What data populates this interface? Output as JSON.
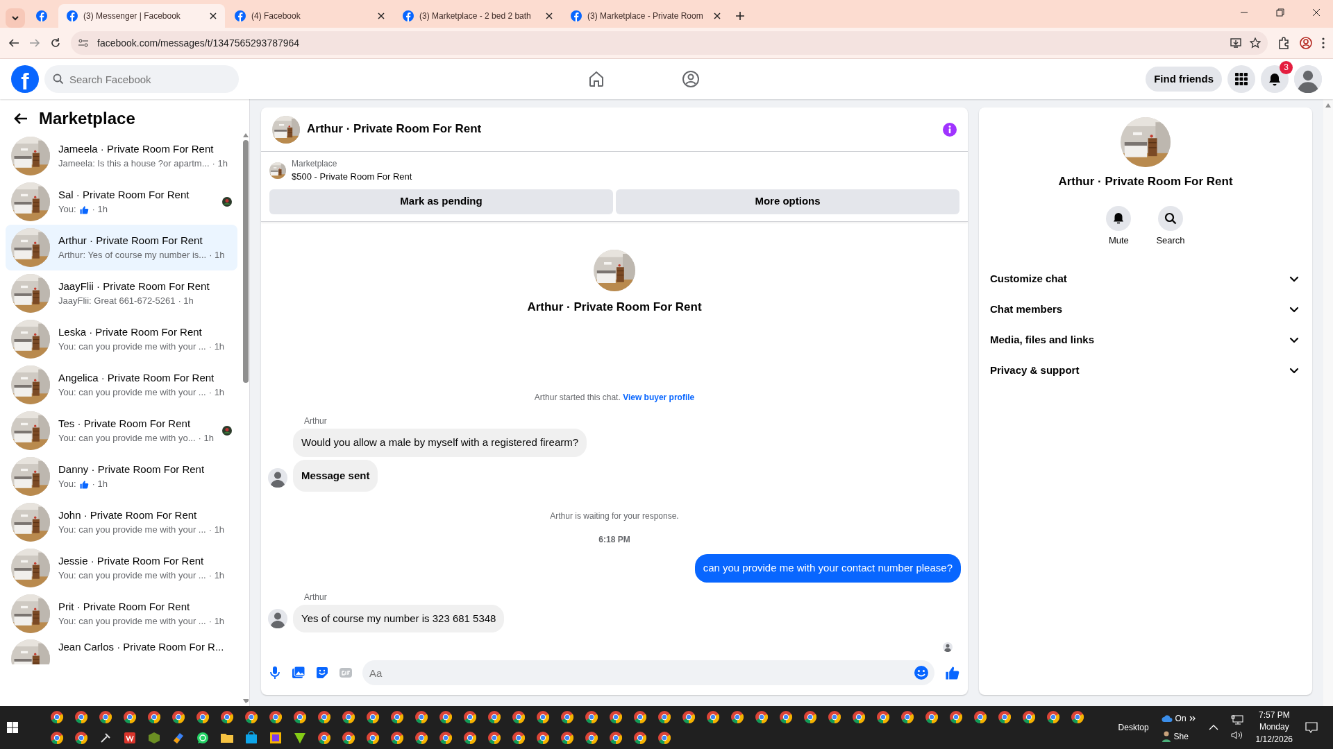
{
  "browser": {
    "tabs": [
      {
        "kind": "pinned",
        "selected": false
      },
      {
        "kind": "page",
        "title": "(3) Messenger | Facebook",
        "selected": true
      },
      {
        "kind": "page",
        "title": "(4) Facebook",
        "selected": false
      },
      {
        "kind": "page",
        "title": "(3) Marketplace - 2 bed 2 bath",
        "selected": false
      },
      {
        "kind": "page",
        "title": "(3) Marketplace - Private Room",
        "selected": false
      }
    ],
    "address": "facebook.com/messages/t/1347565293787964"
  },
  "header": {
    "logo": "f",
    "search_placeholder": "Search Facebook",
    "find_friends": "Find friends",
    "notification_count": "3"
  },
  "sidebar": {
    "title": "Marketplace",
    "conversations": [
      {
        "name": "Jameela · Private Room For Rent",
        "kind": "text",
        "preview": "Jameela: Is this a house ?or apartm...",
        "time": "· 1h",
        "selected": false,
        "read_receipt": false
      },
      {
        "name": "Sal · Private Room For Rent",
        "kind": "like",
        "preview": "You:",
        "time": "· 1h",
        "selected": false,
        "read_receipt": true
      },
      {
        "name": "Arthur · Private Room For Rent",
        "kind": "text",
        "preview": "Arthur: Yes of course my number is...",
        "time": "· 1h",
        "selected": true,
        "read_receipt": false
      },
      {
        "name": "JaayFlii · Private Room For Rent",
        "kind": "text",
        "preview": "JaayFlii: Great 661-672-5261",
        "time": "· 1h",
        "selected": false,
        "read_receipt": false
      },
      {
        "name": "Leska · Private Room For Rent",
        "kind": "text",
        "preview": "You: can you provide me with your ...",
        "time": "· 1h",
        "selected": false,
        "read_receipt": false
      },
      {
        "name": "Angelica · Private Room For Rent",
        "kind": "text",
        "preview": "You: can you provide me with your ...",
        "time": "· 1h",
        "selected": false,
        "read_receipt": false
      },
      {
        "name": "Tes · Private Room For Rent",
        "kind": "text",
        "preview": "You: can you provide me with yo...",
        "time": "· 1h",
        "selected": false,
        "read_receipt": true
      },
      {
        "name": "Danny · Private Room For Rent",
        "kind": "like",
        "preview": "You:",
        "time": "· 1h",
        "selected": false,
        "read_receipt": false
      },
      {
        "name": "John · Private Room For Rent",
        "kind": "text",
        "preview": "You: can you provide me with your ...",
        "time": "· 1h",
        "selected": false,
        "read_receipt": false
      },
      {
        "name": "Jessie · Private Room For Rent",
        "kind": "text",
        "preview": "You: can you provide me with your ...",
        "time": "· 1h",
        "selected": false,
        "read_receipt": false
      },
      {
        "name": "Prit · Private Room For Rent",
        "kind": "text",
        "preview": "You: can you provide me with your ...",
        "time": "· 1h",
        "selected": false,
        "read_receipt": false
      },
      {
        "name": "Jean Carlos · Private Room For R...",
        "kind": "cut",
        "selected": false,
        "read_receipt": false
      }
    ]
  },
  "chat": {
    "title": "Arthur · Private Room For Rent",
    "listing_label": "Marketplace",
    "listing": "$500 - Private Room For Rent",
    "buttons": [
      "Mark as pending",
      "More options"
    ],
    "intro_name": "Arthur · Private Room For Rent",
    "thread": [
      {
        "kind": "system",
        "text": "Arthur started this chat.",
        "link": "View buyer profile"
      },
      {
        "kind": "incoming",
        "sender": "Arthur",
        "bubbles": [
          {
            "text": "Would you allow a male by myself with a registered firearm?",
            "bold": false
          },
          {
            "text": "Message sent",
            "bold": true
          }
        ]
      },
      {
        "kind": "system",
        "text": "Arthur is waiting for your response."
      },
      {
        "kind": "time",
        "text": "6:18 PM"
      },
      {
        "kind": "outgoing",
        "bubbles": [
          {
            "text": "can you provide me with your contact number please?",
            "bold": false
          }
        ]
      },
      {
        "kind": "incoming",
        "sender": "Arthur",
        "bubbles": [
          {
            "text": "Yes of course my number is 323 681 5348",
            "bold": false
          }
        ]
      },
      {
        "kind": "seen"
      }
    ],
    "composer_placeholder": "Aa"
  },
  "details": {
    "name": "Arthur · Private Room For Rent",
    "actions": [
      {
        "kind": "mute",
        "label": "Mute"
      },
      {
        "kind": "search",
        "label": "Search"
      }
    ],
    "sections": [
      {
        "label": "Customize chat",
        "expanded": false
      },
      {
        "label": "Chat members",
        "expanded": false
      },
      {
        "label": "Media, files and links",
        "expanded": false
      },
      {
        "label": "Privacy & support",
        "expanded": false
      }
    ]
  },
  "taskbar": {
    "tray_top": "On",
    "tray_bottom": "She",
    "desktop": "Desktop",
    "time": "7:57 PM",
    "day": "Monday",
    "date": "1/12/2026"
  }
}
